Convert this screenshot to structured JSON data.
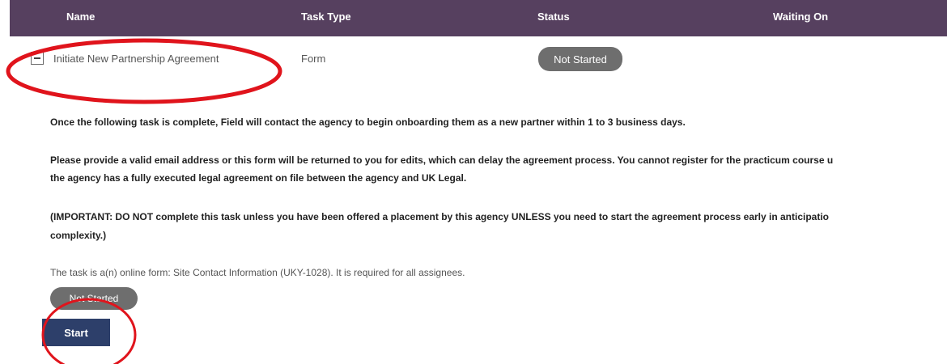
{
  "table": {
    "headers": {
      "name": "Name",
      "task_type": "Task Type",
      "status": "Status",
      "waiting_on": "Waiting On"
    },
    "row": {
      "name": "Initiate New Partnership Agreement",
      "task_type": "Form",
      "status": "Not Started"
    }
  },
  "details": {
    "paragraph_1": "Once the following task is complete, Field will contact the agency to begin onboarding them as a new partner within 1 to 3 business days.",
    "paragraph_2_line_1": "Please provide a valid email address or this form will be returned to you for edits, which can delay the agreement process. You cannot register for the practicum course u",
    "paragraph_2_line_2": "the agency has a fully executed legal agreement on file between the agency and UK Legal.",
    "paragraph_3_line_1": "(IMPORTANT: DO NOT complete this task unless you have been offered a placement by this agency UNLESS you need to start the agreement process early in anticipatio",
    "paragraph_3_line_2": "complexity.)",
    "task_info": "The task is a(n) online form: Site Contact Information (UKY-1028). It is required for all assignees.",
    "status_badge": "Not Started",
    "start_label": "Start"
  },
  "colors": {
    "header_bg": "#56405f",
    "badge_bg": "#6e6e6e",
    "start_button_bg": "#2d3f6a",
    "annotation_red": "#e0141c"
  }
}
